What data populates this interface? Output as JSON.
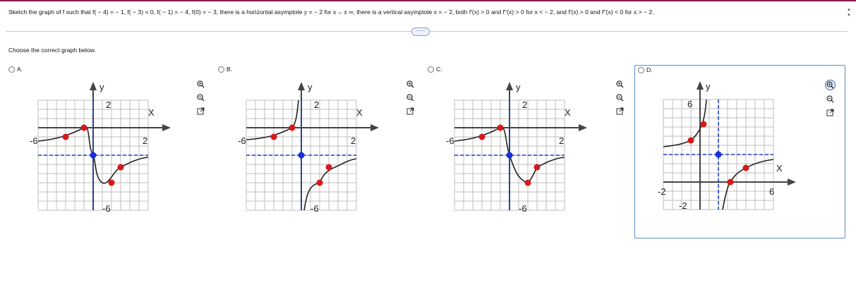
{
  "question": "Sketch the graph of f such that f( − 4) = − 1, f( − 3) = 0, f( − 1) = − 4, f(0) = − 3, there is a horizontal asymptote y = − 2 for x→ ± ∞, there is a vertical asymptote x = − 2, both f′(x) > 0 and f′′(x) > 0 for x < − 2, and f′(x) > 0 and f′′(x) < 0 for x > − 2.",
  "more_button": "⋯⋯",
  "prompt": "Choose the correct graph below.",
  "options": [
    {
      "letter": "A.",
      "selected": false
    },
    {
      "letter": "B.",
      "selected": false
    },
    {
      "letter": "C.",
      "selected": false
    },
    {
      "letter": "D.",
      "selected": true
    }
  ],
  "graph_labels": {
    "y": "y",
    "x": "X",
    "two": "2",
    "six": "6",
    "neg_six": "-6",
    "neg_two": "-2"
  },
  "icons": {
    "zoom_in": "zoom-in-icon",
    "zoom_out": "zoom-out-icon",
    "popout": "popout-icon"
  },
  "colors": {
    "selected_border": "#5b8fc7",
    "asymptote": "#1a3fd1",
    "point": "#d81818",
    "center_point": "#1530e0"
  }
}
